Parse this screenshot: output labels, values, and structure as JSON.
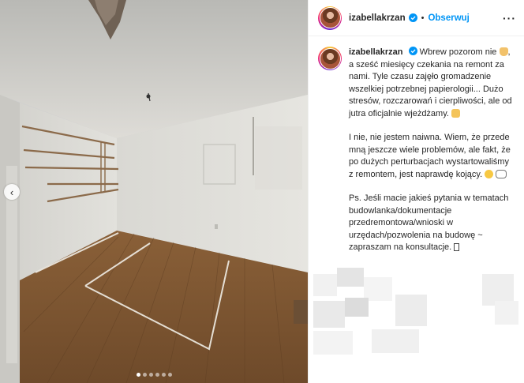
{
  "post": {
    "username": "izabellakrzan",
    "follow_label": "Obserwuj",
    "separator": "•",
    "more_label": "···",
    "carousel": {
      "count": 6,
      "active_index": 0
    },
    "caption": {
      "p1": "Wbrew pozorom nie",
      "p1b": ", a sześć miesięcy czekania na remont za nami. Tyle czasu zajęło gromadzenie wszelkiej potrzebnej papierologii... Dużo stresów, rozczarowań i cierpliwości, ale od jutra oficjalnie wjeżdżamy.",
      "p2": "I nie, nie jestem naiwna. Wiem, że przede mną jeszcze wiele problemów, ale fakt, że po dużych perturbacjach wystartowaliśmy z remontem, jest naprawdę kojący.",
      "p3": "Ps. Jeśli macie jakieś pytania w tematach budowlanka/dokumentacje przedremontowa/wnioski w urzędach/pozwolenia na budowę ~ zapraszam na konsultacje."
    },
    "emoji": [
      "raised-hand-emoji",
      "construction-worker-emoji",
      "surprised-face-emoji",
      "pointing-hand-emoji",
      "unknown-glyph"
    ],
    "colors": {
      "accent": "#0095f6",
      "text": "#262626",
      "border": "#efefef"
    }
  }
}
